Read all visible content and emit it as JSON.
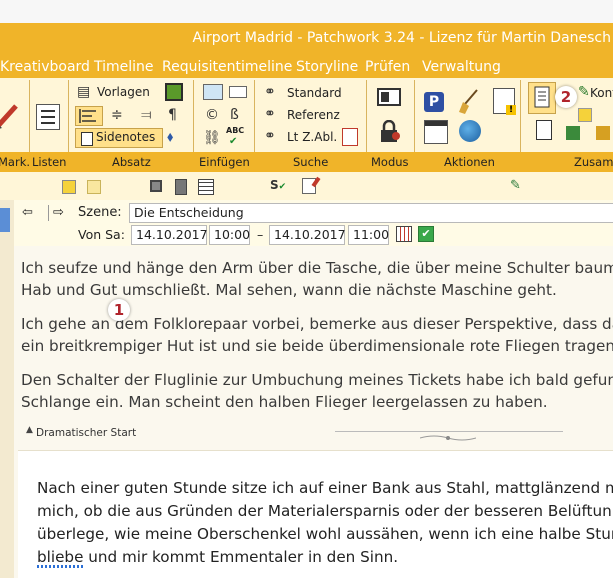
{
  "window": {
    "title": "Airport Madrid  -  Patchwork 3.24  -  Lizenz für Martin Danesch"
  },
  "menu": [
    "Kreativboard",
    "Timeline",
    "Requisitentimeline",
    "Storyline",
    "Prüfen",
    "Verwaltung"
  ],
  "ribbon": {
    "groups": [
      "Mark.",
      "Listen",
      "Absatz",
      "Einfügen",
      "Suche",
      "Modus",
      "Aktionen",
      "Zusam"
    ],
    "absatz": {
      "vorlagen": "Vorlagen",
      "sidenotes": "Sidenotes"
    },
    "einfuegen": {
      "copyright": "©",
      "eszett": "ß",
      "abc": "ABC"
    },
    "suche": {
      "standard": "Standard",
      "referenz": "Referenz",
      "ltzabl": "Lt Z.Abl."
    },
    "zusam": {
      "konf": "Konf"
    }
  },
  "scene": {
    "label": "Szene:",
    "name": "Die Entscheidung",
    "von_label": "Von Sa:",
    "start_date": "14.10.2017",
    "start_time": "10:00",
    "dash": "–",
    "end_date": "14.10.2017",
    "end_time": "11:00"
  },
  "text": {
    "p1l1": "Ich seufze und hänge den Arm über die Tasche, die über meine Schulter baume",
    "p1l2": "Hab und Gut umschließt. Mal sehen, wann die nächste Maschine geht.",
    "p2l1": "Ich gehe an dem Folklorepaar vorbei, bemerke aus dieser Perspektive, dass da",
    "p2l2": "ein breitkrempiger Hut ist und sie beide überdimensionale rote Fliegen tragen.",
    "p3l1": "Den Schalter der Fluglinie zur Umbuchung meines Tickets habe ich bald gefund",
    "p3l2": "Schlange ein. Man scheint den halben Flieger leergelassen zu haben.",
    "section": "Dramatischer Start",
    "q1": "Nach einer guten Stunde sitze ich auf einer Bank aus Stahl, mattglänzend mit",
    "q2": "mich, ob die aus Gründen der Materialersparnis oder der besseren Belüftun",
    "q3": "überlege, wie meine Oberschenkel wohl aussähen, wenn ich eine halbe Stund",
    "q4": "bliebe und mir kommt Emmentaler in den Sinn."
  },
  "badges": [
    "1",
    "2"
  ],
  "colors": {
    "accent": "#f0b429",
    "ribbon_bg": "#fff6d8",
    "badge_text": "#b0242c"
  }
}
